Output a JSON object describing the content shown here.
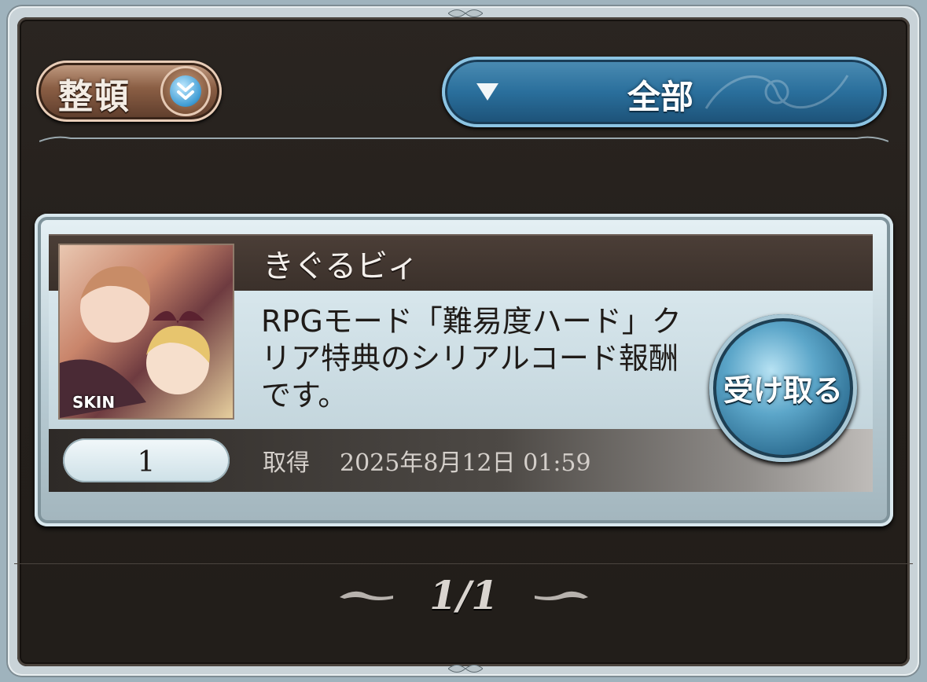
{
  "toolbar": {
    "sort_label": "整頓",
    "filter_label": "全部",
    "sort_icon": "chevron-double-down-icon",
    "filter_icon": "triangle-down-icon"
  },
  "mail": {
    "sender": "きぐるビィ",
    "message": "RPGモード「難易度ハード」クリア特典のシリアルコード報酬です。",
    "thumbnail_tag": "SKIN",
    "quantity": "1",
    "received_label": "取得",
    "received_date": "2025年8月12日 01:59",
    "receive_button": "受け取る"
  },
  "pagination": {
    "current": "1/1"
  },
  "colors": {
    "panel": "#241f1b",
    "accent_blue": "#2a6f9c",
    "sort_bronze": "#8a5e44"
  }
}
